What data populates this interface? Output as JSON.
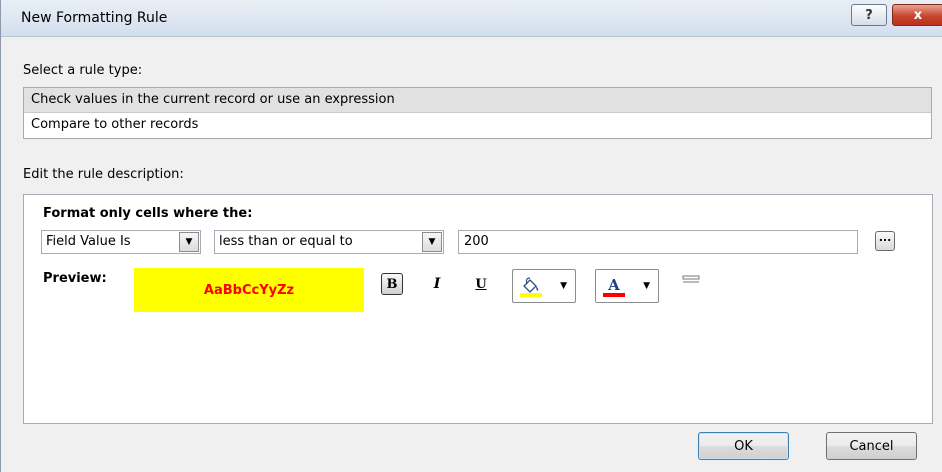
{
  "dialog": {
    "title": "New Formatting Rule",
    "help_label": "?",
    "close_label": "x"
  },
  "rule_type": {
    "label": "Select a rule type:",
    "items": [
      {
        "label": "Check values in the current record or use an expression",
        "selected": true
      },
      {
        "label": "Compare to other records",
        "selected": false
      }
    ]
  },
  "description": {
    "label": "Edit the rule description:",
    "format_title": "Format only cells where the:",
    "field_select": "Field Value Is",
    "operator_select": "less than or equal to",
    "value": "200",
    "ellipsis_label": "..."
  },
  "preview": {
    "label": "Preview:",
    "sample_text": "AaBbCcYyZz",
    "background_color": "#ffff00",
    "text_color": "#ff0000"
  },
  "format_toolbar": {
    "bold_label": "B",
    "italic_label": "I",
    "underline_label": "U",
    "fill_icon": "paint-bucket-icon",
    "font_color_icon": "font-color-icon",
    "fill_color": "#ffff00",
    "font_color": "#ff0000"
  },
  "buttons": {
    "ok": "OK",
    "cancel": "Cancel"
  }
}
